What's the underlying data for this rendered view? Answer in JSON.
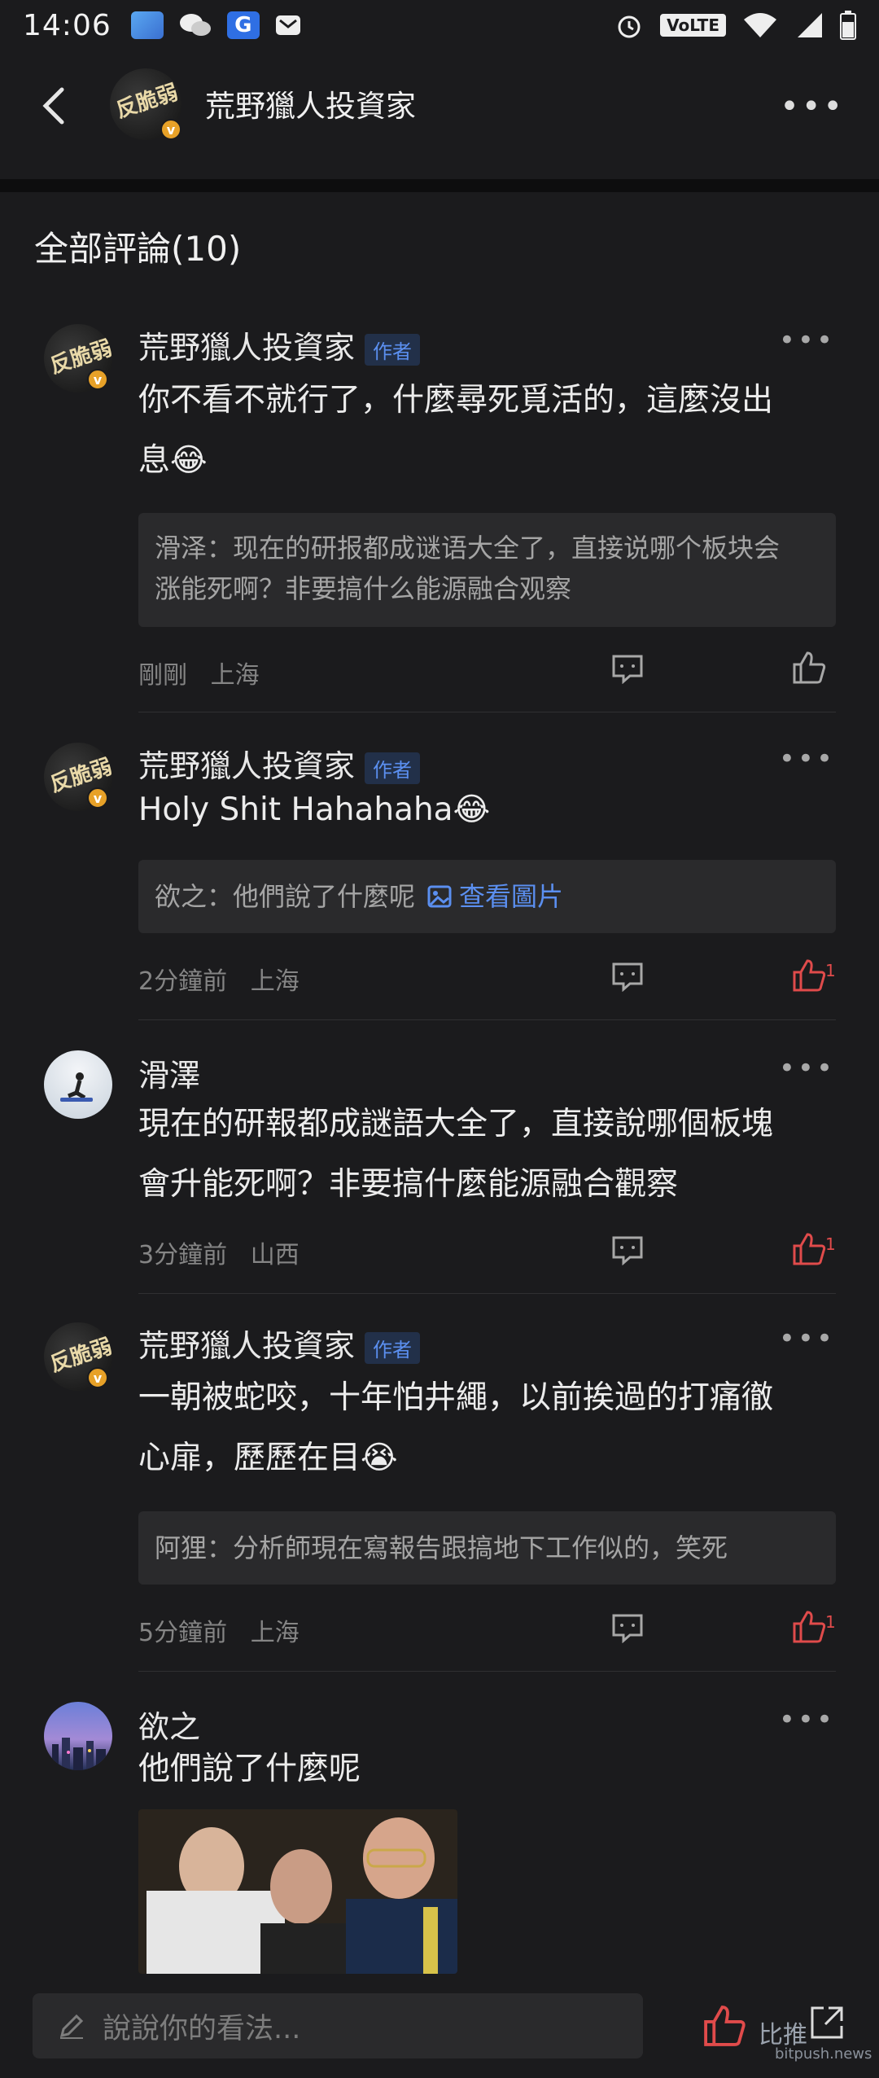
{
  "status_bar": {
    "time": "14:06",
    "volte": "VoLTE"
  },
  "header": {
    "title": "荒野獵人投資家",
    "avatar_text": "反脆弱",
    "more": "•••"
  },
  "section": {
    "title": "全部評論(10)"
  },
  "comments": [
    {
      "name": "荒野獵人投資家",
      "author_tag": "作者",
      "text_line1": "你不看不就行了，什麼尋死覓活的，這麼沒出",
      "text_line2": "息😂",
      "quote_line1": "滑泽：现在的研报都成谜语大全了，直接说哪个板块会",
      "quote_line2": "涨能死啊？非要搞什么能源融合观察",
      "time": "剛剛",
      "location": "上海",
      "likes": ""
    },
    {
      "name": "荒野獵人投資家",
      "author_tag": "作者",
      "text_line1": "Holy Shit Hahahaha😂",
      "quote_text": "欲之：他們說了什麼呢",
      "quote_link": "查看圖片",
      "time": "2分鐘前",
      "location": "上海",
      "likes": "1"
    },
    {
      "name": "滑澤",
      "text_line1": "現在的研報都成謎語大全了，直接說哪個板塊",
      "text_line2": "會升能死啊？非要搞什麼能源融合觀察",
      "time": "3分鐘前",
      "location": "山西",
      "likes": "1"
    },
    {
      "name": "荒野獵人投資家",
      "author_tag": "作者",
      "text_line1": "一朝被蛇咬，十年怕井繩，以前挨過的打痛徹",
      "text_line2": "心扉，歷歷在目😭",
      "quote_text": "阿狸：分析師現在寫報告跟搞地下工作似的，笑死",
      "time": "5分鐘前",
      "location": "上海",
      "likes": "1"
    },
    {
      "name": "欲之",
      "text_line1": "他們說了什麼呢"
    }
  ],
  "bottom_bar": {
    "placeholder": "說說你的看法...",
    "watermark": "比推",
    "watermark_url": "bitpush.news"
  },
  "colors": {
    "background": "#1b1b1d",
    "accent_blue": "#5b8ff0",
    "like_red": "#e04b4b",
    "badge_gold": "#e7a128"
  }
}
